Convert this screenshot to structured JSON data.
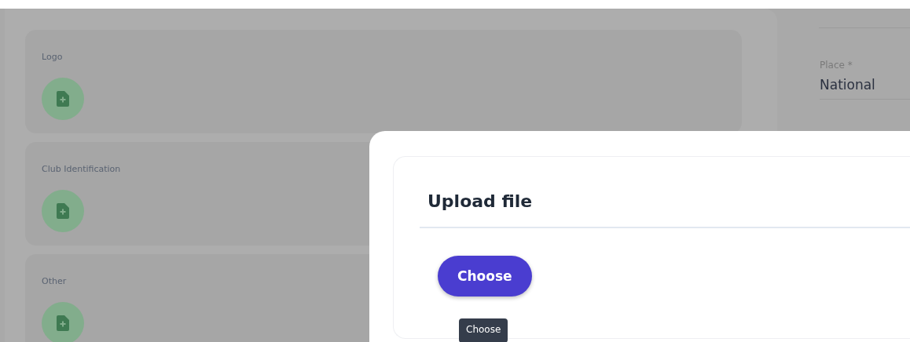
{
  "cards": [
    {
      "label": "Logo"
    },
    {
      "label": "Club Identification"
    },
    {
      "label": "Other"
    }
  ],
  "side_field": {
    "label": "Place *",
    "value": "National"
  },
  "dialog": {
    "title": "Upload file",
    "button": "Choose",
    "tooltip": "Choose"
  }
}
